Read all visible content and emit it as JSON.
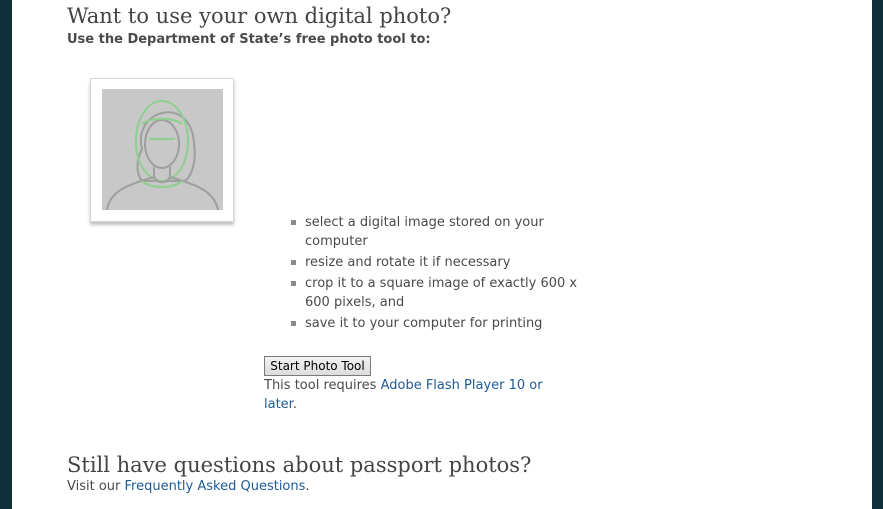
{
  "section1": {
    "title": "Want to use your own digital photo?",
    "subtitle": "Use the Department of State’s free photo tool to:"
  },
  "photo": {
    "icon": "passport-photo-silhouette-icon"
  },
  "steps": [
    "select a digital image stored on your computer",
    "resize and rotate it if necessary",
    "crop it to a square image of exactly 600 x 600 pixels, and",
    "save it to your computer for printing"
  ],
  "tool": {
    "button_label": "Start Photo Tool",
    "requires_text": "This tool requires ",
    "requires_link": "Adobe Flash Player 10 or later",
    "requires_tail": "."
  },
  "section2": {
    "title": "Still have questions about passport photos?",
    "visit_text": "Visit our ",
    "faq_link": "Frequently Asked Questions",
    "visit_tail": "."
  },
  "colors": {
    "background": "#0f2f3a",
    "link": "#1d5a96",
    "text": "#4a4a4a",
    "face_outline": "#8fcf8f"
  }
}
